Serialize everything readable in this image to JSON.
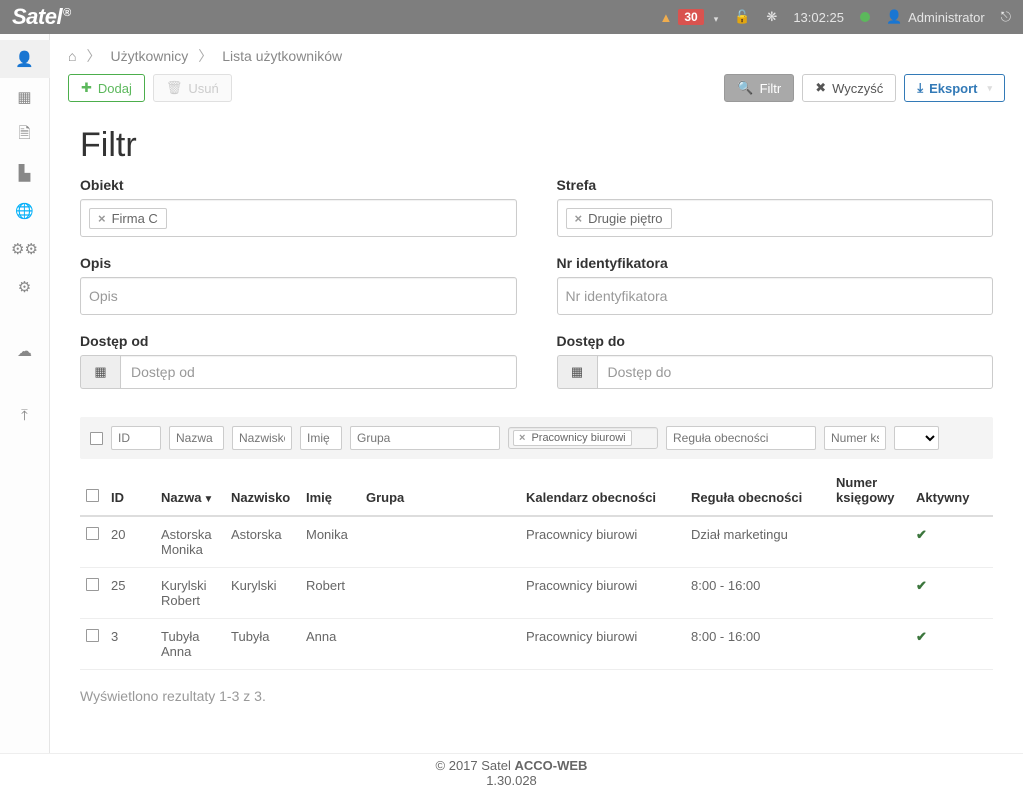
{
  "topbar": {
    "logo": "Satel",
    "alert_count": "30",
    "time": "13:02:25",
    "user": "Administrator"
  },
  "breadcrumb": {
    "users": "Użytkownicy",
    "list": "Lista użytkowników"
  },
  "buttons": {
    "add": "Dodaj",
    "delete": "Usuń",
    "filter": "Filtr",
    "clear": "Wyczyść",
    "export": "Eksport"
  },
  "filter": {
    "title": "Filtr",
    "obiekt_label": "Obiekt",
    "obiekt_tag": "Firma C",
    "strefa_label": "Strefa",
    "strefa_tag": "Drugie piętro",
    "opis_label": "Opis",
    "opis_placeholder": "Opis",
    "nrid_label": "Nr identyfikatora",
    "nrid_placeholder": "Nr identyfikatora",
    "od_label": "Dostęp od",
    "od_placeholder": "Dostęp od",
    "do_label": "Dostęp do",
    "do_placeholder": "Dostęp do"
  },
  "col_filters": {
    "id": "ID",
    "nazwa": "Nazwa",
    "nazwisko": "Nazwisko",
    "imie": "Imię",
    "grupa": "Grupa",
    "kal_tag": "Pracownicy biurowi",
    "reg": "Reguła obecności",
    "num": "Numer księg"
  },
  "headers": {
    "id": "ID",
    "nazwa": "Nazwa",
    "nazwisko": "Nazwisko",
    "imie": "Imię",
    "grupa": "Grupa",
    "kal": "Kalendarz obecności",
    "reg": "Reguła obecności",
    "num": "Numer księgowy",
    "aktywny": "Aktywny"
  },
  "rows": [
    {
      "id": "20",
      "nazwa": "Astorska Monika",
      "nazwisko": "Astorska",
      "imie": "Monika",
      "grupa": "",
      "kal": "Pracownicy biurowi",
      "reg": "Dział marketingu",
      "num": "",
      "aktywny": true
    },
    {
      "id": "25",
      "nazwa": "Kurylski Robert",
      "nazwisko": "Kurylski",
      "imie": "Robert",
      "grupa": "",
      "kal": "Pracownicy biurowi",
      "reg": "8:00 - 16:00",
      "num": "",
      "aktywny": true
    },
    {
      "id": "3",
      "nazwa": "Tubyła Anna",
      "nazwisko": "Tubyła",
      "imie": "Anna",
      "grupa": "",
      "kal": "Pracownicy biurowi",
      "reg": "8:00 - 16:00",
      "num": "",
      "aktywny": true
    }
  ],
  "results": "Wyświetlono rezultaty 1-3 z 3.",
  "footer": {
    "copy": "© 2017 Satel",
    "product": "ACCO-WEB",
    "version": "1.30.028"
  }
}
